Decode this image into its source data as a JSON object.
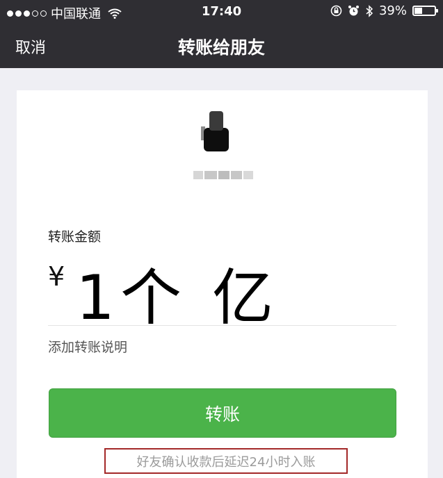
{
  "status_bar": {
    "carrier": "中国联通",
    "time": "17:40",
    "battery": "39%",
    "battery_level": 0.39
  },
  "nav": {
    "back_label": "取消",
    "title": "转账给朋友"
  },
  "form": {
    "amount_label": "转账金额",
    "currency_symbol": "¥",
    "amount_value": "1个 亿",
    "note_link": "添加转账说明",
    "submit_label": "转账",
    "delay_notice": "好友确认收款后延迟24小时入账"
  },
  "colors": {
    "nav_background": "#2f2e33",
    "button_green": "#4bb34a",
    "notice_border": "#a32828"
  }
}
